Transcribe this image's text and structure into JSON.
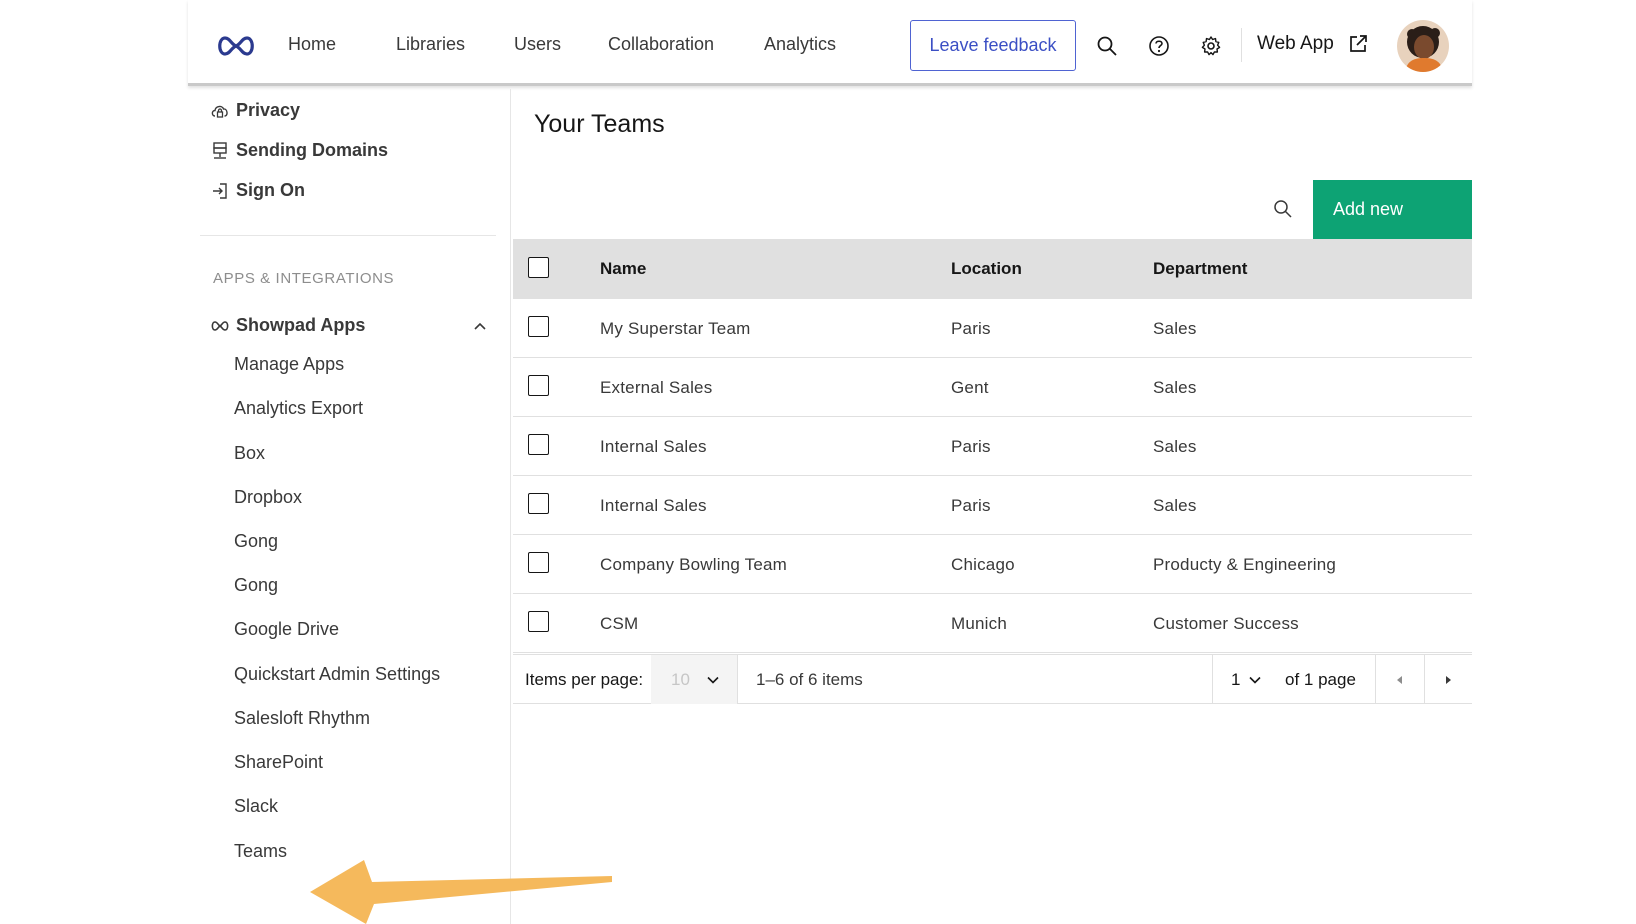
{
  "nav": {
    "links": [
      "Home",
      "Libraries",
      "Users",
      "Collaboration",
      "Analytics"
    ],
    "feedback_label": "Leave feedback",
    "webapp_label": "Web App",
    "icons": [
      "infinity-logo-icon",
      "search-icon",
      "help-icon",
      "settings-icon",
      "external-link-icon"
    ]
  },
  "sidebar": {
    "top_items": [
      {
        "label": "Privacy",
        "icon": "cloud-lock-icon"
      },
      {
        "label": "Sending Domains",
        "icon": "server-icon"
      },
      {
        "label": "Sign On",
        "icon": "sign-in-icon"
      }
    ],
    "section_label": "APPS & INTEGRATIONS",
    "group_label": "Showpad Apps",
    "group_expanded": true,
    "sub_items": [
      "Manage Apps",
      "Analytics Export",
      "Box",
      "Dropbox",
      "Gong",
      "Gong",
      "Google Drive",
      "Quickstart Admin Settings",
      "Salesloft Rhythm",
      "SharePoint",
      "Slack",
      "Teams"
    ]
  },
  "main": {
    "title": "Your Teams",
    "add_label": "Add new",
    "add_color": "#0da374",
    "columns": [
      "Name",
      "Location",
      "Department"
    ],
    "rows": [
      {
        "name": "My Superstar Team",
        "location": "Paris",
        "department": "Sales"
      },
      {
        "name": "External Sales",
        "location": "Gent",
        "department": "Sales"
      },
      {
        "name": "Internal Sales",
        "location": "Paris",
        "department": "Sales"
      },
      {
        "name": "Internal Sales",
        "location": "Paris",
        "department": "Sales"
      },
      {
        "name": "Company Bowling Team",
        "location": "Chicago",
        "department": "Producty & Engineering"
      },
      {
        "name": "CSM",
        "location": "Munich",
        "department": "Customer Success"
      }
    ]
  },
  "pagination": {
    "items_per_page_label": "Items per page:",
    "items_per_page": "10",
    "range_text": "1–6 of 6 items",
    "current_page": "1",
    "pages_text": "of 1 page"
  },
  "annotation": {
    "arrow_color": "#f5b95c"
  }
}
